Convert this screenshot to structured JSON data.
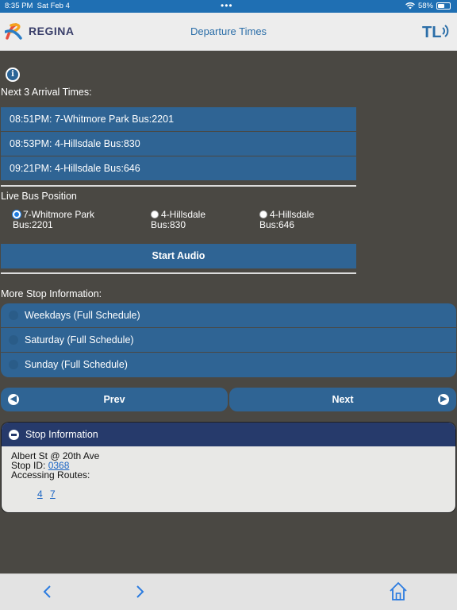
{
  "status_bar": {
    "time": "8:35 PM",
    "date": "Sat Feb 4",
    "battery": "58%",
    "battery_level": 0.58
  },
  "header": {
    "brand": "REGINA",
    "title": "Departure Times"
  },
  "arrivals_label": "Next 3 Arrival Times:",
  "arrivals": [
    "08:51PM: 7-Whitmore Park Bus:2201",
    "08:53PM: 4-Hillsdale Bus:830",
    "09:21PM: 4-Hillsdale Bus:646"
  ],
  "live_position_label": "Live Bus Position",
  "bus_options": [
    {
      "route": "7-Whitmore Park",
      "bus": "Bus:2201",
      "selected": true
    },
    {
      "route": "4-Hillsdale",
      "bus": "Bus:830",
      "selected": false
    },
    {
      "route": "4-Hillsdale",
      "bus": "Bus:646",
      "selected": false
    }
  ],
  "start_audio_label": "Start Audio",
  "more_info_label": "More Stop Information:",
  "schedules": [
    "Weekdays (Full Schedule)",
    "Saturday (Full Schedule)",
    "Sunday (Full Schedule)"
  ],
  "nav": {
    "prev": "Prev",
    "next": "Next"
  },
  "stop_info": {
    "title": "Stop Information",
    "address": "Albert St @ 20th Ave",
    "stop_id_label": "Stop ID:",
    "stop_id": "0368",
    "routes_label": "Accessing Routes:",
    "routes": [
      "4",
      "7"
    ]
  },
  "colors": {
    "accent": "#2f6494",
    "background": "#4a4843",
    "status_bar": "#1f6fb3",
    "panel_header": "#263a6b"
  },
  "icons": {
    "info": "info-icon",
    "back": "chevron-left-icon",
    "forward": "chevron-right-icon",
    "home": "home-icon"
  }
}
